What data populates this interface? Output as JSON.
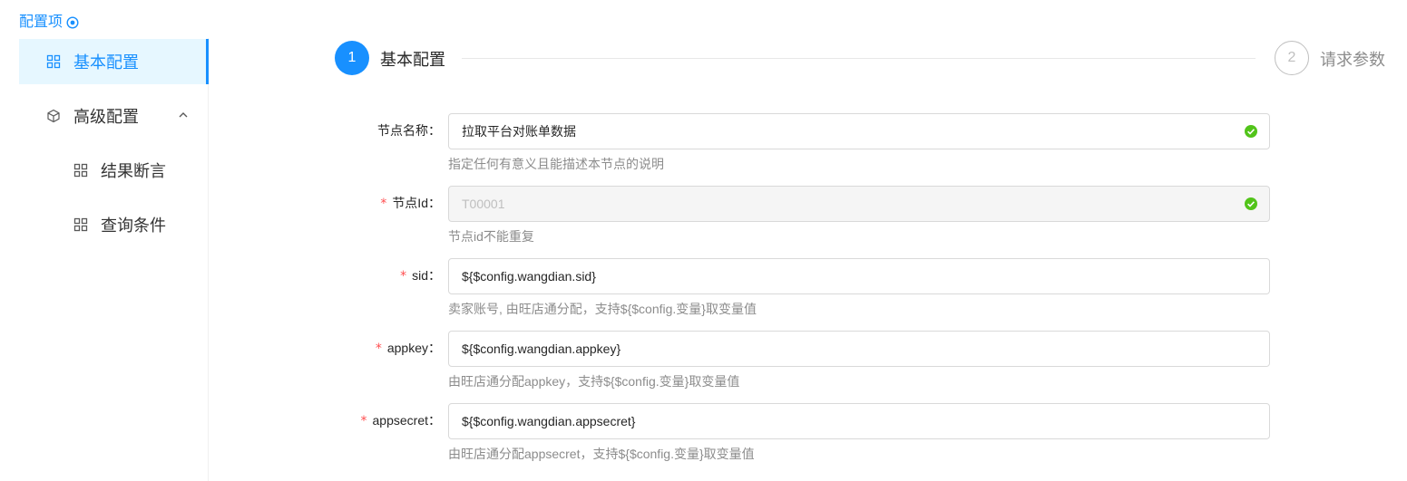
{
  "sidebar": {
    "title": "配置项",
    "items": [
      {
        "label": "基本配置"
      },
      {
        "label": "高级配置"
      },
      {
        "label": "结果断言"
      },
      {
        "label": "查询条件"
      }
    ]
  },
  "steps": [
    {
      "number": "1",
      "label": "基本配置"
    },
    {
      "number": "2",
      "label": "请求参数"
    }
  ],
  "form": {
    "fields": [
      {
        "label": "节点名称：",
        "required": false,
        "value": "拉取平台对账单数据",
        "help": "指定任何有意义且能描述本节点的说明"
      },
      {
        "label": "节点Id：",
        "required": true,
        "value": "T00001",
        "help": "节点id不能重复"
      },
      {
        "label": "sid：",
        "required": true,
        "value": "${$config.wangdian.sid}",
        "help": "卖家账号, 由旺店通分配，支持${$config.变量}取变量值"
      },
      {
        "label": "appkey：",
        "required": true,
        "value": "${$config.wangdian.appkey}",
        "help": "由旺店通分配appkey，支持${$config.变量}取变量值"
      },
      {
        "label": "appsecret：",
        "required": true,
        "value": "${$config.wangdian.appsecret}",
        "help": "由旺店通分配appsecret，支持${$config.变量}取变量值"
      }
    ]
  },
  "colors": {
    "primary": "#1890ff",
    "success": "#52c41a",
    "required": "#ff4d4f"
  }
}
